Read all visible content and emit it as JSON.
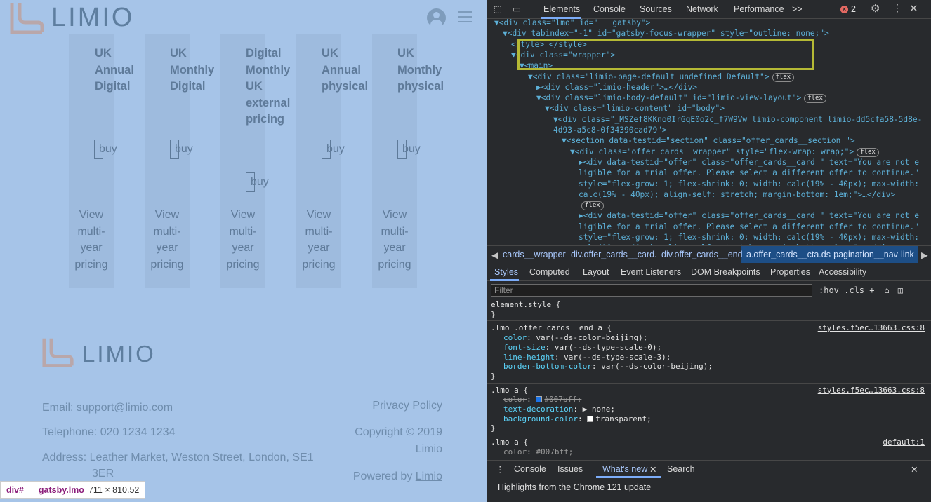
{
  "site": {
    "logo_text": "LIMIO",
    "cards": [
      {
        "title": "UK\nAnnual\nDigital",
        "buy": "buy",
        "more": "View\nmulti-\nyear\npricing"
      },
      {
        "title": "UK\nMonthly\nDigital",
        "buy": "buy",
        "more": "View\nmulti-\nyear\npricing"
      },
      {
        "title": "Digital\nMonthly\nUK\nexternal\npricing",
        "buy": "buy",
        "more": "View\nmulti-\nyear\npricing"
      },
      {
        "title": "UK\nAnnual\nphysical",
        "buy": "buy",
        "more": "View\nmulti-\nyear\npricing"
      },
      {
        "title": "UK\nMonthly\nphysical",
        "buy": "buy",
        "more": "View\nmulti-\nyear\npricing"
      }
    ],
    "footer": {
      "logo_text": "LIMIO",
      "email": "Email:  support@limio.com",
      "phone": "Telephone:  020 1234 1234",
      "address_1": "Address:  Leather Market, Weston Street, London, SE1",
      "address_2": "3ER",
      "privacy": "Privacy Policy",
      "copyright_1": "Copyright © 2019",
      "copyright_2": "Limio",
      "powered_prefix": "Powered by ",
      "powered_link": "Limio"
    },
    "inspect_tag": {
      "name": "div#___gatsby.lmo",
      "size": "711 × 810.52"
    }
  },
  "devtools": {
    "tabs": [
      "Elements",
      "Console",
      "Sources",
      "Network",
      "Performance"
    ],
    "more_tabs": ">>",
    "error_count": "2",
    "dom_lines": [
      {
        "indent": 0,
        "html": "▼<div class=\"lmo\" id=\"___gatsby\">"
      },
      {
        "indent": 1,
        "html": "▼<div tabindex=\"-1\" id=\"gatsby-focus-wrapper\" style=\"outline: none;\">"
      },
      {
        "indent": 2,
        "html": "<style> </style>"
      },
      {
        "indent": 2,
        "html": "▼<div class=\"wrapper\">"
      },
      {
        "indent": 3,
        "html": "▼<main>"
      },
      {
        "indent": 4,
        "html": "▼<div class=\"limio-page-default undefined Default\">",
        "pill": "flex"
      },
      {
        "indent": 5,
        "html": "▶<div class=\"limio-header\">…</div>"
      },
      {
        "indent": 5,
        "html": "▼<div class=\"limio-body-default\" id=\"limio-view-layout\">",
        "pill": "flex"
      },
      {
        "indent": 6,
        "html": "▼<div class=\"limio-content\" id=\"body\">"
      },
      {
        "indent": 7,
        "html": "▼<div class=\"_MSZef8KKno0IrGqE0o2c_f7W9Vw limio-component limio-dd5cfa58-5d8e-"
      },
      {
        "indent": 7,
        "html": "  4d93-a5c8-0f34390cad79\">"
      },
      {
        "indent": 8,
        "html": "▼<section data-testid=\"section\" class=\"offer_cards__section \">"
      },
      {
        "indent": 9,
        "html": "▼<div class=\"offer_cards__wrapper\" style=\"flex-wrap: wrap;\">",
        "pill": "flex"
      },
      {
        "indent": 10,
        "html": "▶<div data-testid=\"offer\" class=\"offer_cards__card  \" text=\"You are not e"
      },
      {
        "indent": 10,
        "html": "  ligible for a trial offer. Please select a different offer to continue.\""
      },
      {
        "indent": 10,
        "html": "  style=\"flex-grow: 1; flex-shrink: 0; width: calc(19% - 40px); max-width:"
      },
      {
        "indent": 10,
        "html": "  calc(19% - 40px); align-self: stretch; margin-bottom: 1em;\">…</div>"
      },
      {
        "indent": 10,
        "html": "  ",
        "pill": "flex"
      },
      {
        "indent": 10,
        "html": "▶<div data-testid=\"offer\" class=\"offer_cards__card  \" text=\"You are not e"
      },
      {
        "indent": 10,
        "html": "  ligible for a trial offer. Please select a different offer to continue.\""
      },
      {
        "indent": 10,
        "html": "  style=\"flex-grow: 1; flex-shrink: 0; width: calc(19% - 40px); max-width:"
      },
      {
        "indent": 10,
        "html": "  calc(19% - 40px); align-self: stretch; margin-bottom: 1em;\">…</div>"
      }
    ],
    "breadcrumbs": [
      "cards__wrapper",
      "div.offer_cards__card.",
      "div.offer_cards__end",
      "a.offer_cards__cta.ds-pagination__nav-link"
    ],
    "style_tabs": [
      "Styles",
      "Computed",
      "Layout",
      "Event Listeners",
      "DOM Breakpoints",
      "Properties",
      "Accessibility"
    ],
    "filter_placeholder": "Filter",
    "filter_tools": ":hov  .cls  +",
    "rules": [
      {
        "selector": "element.style {",
        "source": "",
        "props": []
      },
      {
        "selector": ".lmo .offer_cards__end a {",
        "source": "styles.f5ec…13663.css:8",
        "props": [
          {
            "n": "color",
            "v": "var(--ds-color-beijing);"
          },
          {
            "n": "font-size",
            "v": "var(--ds-type-scale-0);"
          },
          {
            "n": "line-height",
            "v": "var(--ds-type-scale-3);"
          },
          {
            "n": "border-bottom-color",
            "v": "var(--ds-color-beijing);"
          }
        ]
      },
      {
        "selector": ".lmo a {",
        "source": "styles.f5ec…13663.css:8",
        "props": [
          {
            "n": "color",
            "v": "#007bff;",
            "strike": true,
            "swatch": "#1a73e8"
          },
          {
            "n": "text-decoration",
            "v": "▶ none;"
          },
          {
            "n": "background-color",
            "v": "transparent;",
            "swatch": "#ffffff"
          }
        ]
      },
      {
        "selector": ".lmo a {",
        "source": "default:1",
        "props": [
          {
            "n": "color",
            "v": "#007bff;",
            "strike": true
          }
        ]
      }
    ],
    "drawer_tabs": [
      "Console",
      "Issues",
      "What's new",
      "Search"
    ],
    "drawer_message": "Highlights from the Chrome 121 update"
  }
}
